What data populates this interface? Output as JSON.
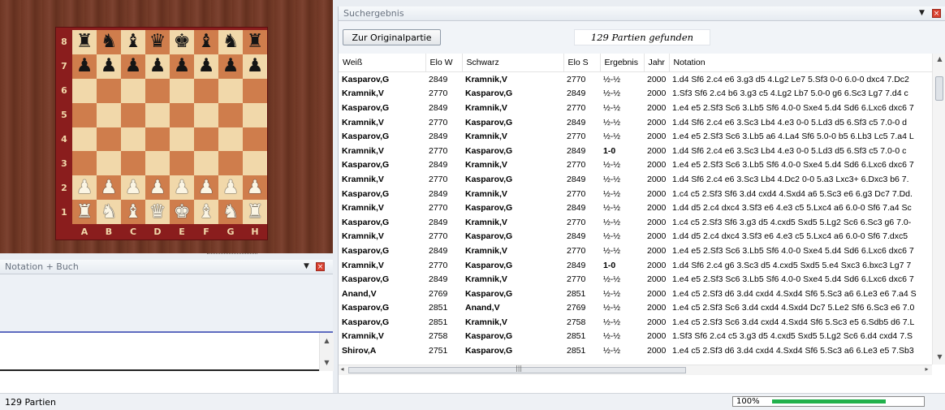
{
  "board": {
    "ranks": [
      "8",
      "7",
      "6",
      "5",
      "4",
      "3",
      "2",
      "1"
    ],
    "files": [
      "A",
      "B",
      "C",
      "D",
      "E",
      "F",
      "G",
      "H"
    ],
    "position": [
      [
        "br",
        "bn",
        "bb",
        "bq",
        "bk",
        "bb",
        "bn",
        "br"
      ],
      [
        "bp",
        "bp",
        "bp",
        "bp",
        "bp",
        "bp",
        "bp",
        "bp"
      ],
      [
        "",
        "",
        "",
        "",
        "",
        "",
        "",
        ""
      ],
      [
        "",
        "",
        "",
        "",
        "",
        "",
        "",
        ""
      ],
      [
        "",
        "",
        "",
        "",
        "",
        "",
        "",
        ""
      ],
      [
        "",
        "",
        "",
        "",
        "",
        "",
        "",
        ""
      ],
      [
        "wp",
        "wp",
        "wp",
        "wp",
        "wp",
        "wp",
        "wp",
        "wp"
      ],
      [
        "wr",
        "wn",
        "wb",
        "wq",
        "wk",
        "wb",
        "wn",
        "wr"
      ]
    ]
  },
  "notation_panel": {
    "title": "Notation + Buch"
  },
  "result_panel": {
    "title": "Suchergebnis",
    "original_button": "Zur Originalpartie",
    "found_text": "129 Partien gefunden",
    "columns": [
      "Weiß",
      "Elo W",
      "Schwarz",
      "Elo S",
      "Ergebnis",
      "Jahr",
      "Notation"
    ],
    "rows": [
      [
        "Kasparov,G",
        "2849",
        "Kramnik,V",
        "2770",
        "½-½",
        "2000",
        "1.d4 Sf6 2.c4 e6 3.g3 d5 4.Lg2 Le7 5.Sf3 0-0 6.0-0 dxc4 7.Dc2"
      ],
      [
        "Kramnik,V",
        "2770",
        "Kasparov,G",
        "2849",
        "½-½",
        "2000",
        "1.Sf3 Sf6 2.c4 b6 3.g3 c5 4.Lg2 Lb7 5.0-0 g6 6.Sc3 Lg7 7.d4 c"
      ],
      [
        "Kasparov,G",
        "2849",
        "Kramnik,V",
        "2770",
        "½-½",
        "2000",
        "1.e4 e5 2.Sf3 Sc6 3.Lb5 Sf6 4.0-0 Sxe4 5.d4 Sd6 6.Lxc6 dxc6 7"
      ],
      [
        "Kramnik,V",
        "2770",
        "Kasparov,G",
        "2849",
        "½-½",
        "2000",
        "1.d4 Sf6 2.c4 e6 3.Sc3 Lb4 4.e3 0-0 5.Ld3 d5 6.Sf3 c5 7.0-0 d"
      ],
      [
        "Kasparov,G",
        "2849",
        "Kramnik,V",
        "2770",
        "½-½",
        "2000",
        "1.e4 e5 2.Sf3 Sc6 3.Lb5 a6 4.La4 Sf6 5.0-0 b5 6.Lb3 Lc5 7.a4 L"
      ],
      [
        "Kramnik,V",
        "2770",
        "Kasparov,G",
        "2849",
        "1-0",
        "2000",
        "1.d4 Sf6 2.c4 e6 3.Sc3 Lb4 4.e3 0-0 5.Ld3 d5 6.Sf3 c5 7.0-0 c"
      ],
      [
        "Kasparov,G",
        "2849",
        "Kramnik,V",
        "2770",
        "½-½",
        "2000",
        "1.e4 e5 2.Sf3 Sc6 3.Lb5 Sf6 4.0-0 Sxe4 5.d4 Sd6 6.Lxc6 dxc6 7"
      ],
      [
        "Kramnik,V",
        "2770",
        "Kasparov,G",
        "2849",
        "½-½",
        "2000",
        "1.d4 Sf6 2.c4 e6 3.Sc3 Lb4 4.Dc2 0-0 5.a3 Lxc3+ 6.Dxc3 b6 7."
      ],
      [
        "Kasparov,G",
        "2849",
        "Kramnik,V",
        "2770",
        "½-½",
        "2000",
        "1.c4 c5 2.Sf3 Sf6 3.d4 cxd4 4.Sxd4 a6 5.Sc3 e6 6.g3 Dc7 7.Dd."
      ],
      [
        "Kramnik,V",
        "2770",
        "Kasparov,G",
        "2849",
        "½-½",
        "2000",
        "1.d4 d5 2.c4 dxc4 3.Sf3 e6 4.e3 c5 5.Lxc4 a6 6.0-0 Sf6 7.a4 Sc"
      ],
      [
        "Kasparov,G",
        "2849",
        "Kramnik,V",
        "2770",
        "½-½",
        "2000",
        "1.c4 c5 2.Sf3 Sf6 3.g3 d5 4.cxd5 Sxd5 5.Lg2 Sc6 6.Sc3 g6 7.0-"
      ],
      [
        "Kramnik,V",
        "2770",
        "Kasparov,G",
        "2849",
        "½-½",
        "2000",
        "1.d4 d5 2.c4 dxc4 3.Sf3 e6 4.e3 c5 5.Lxc4 a6 6.0-0 Sf6 7.dxc5"
      ],
      [
        "Kasparov,G",
        "2849",
        "Kramnik,V",
        "2770",
        "½-½",
        "2000",
        "1.e4 e5 2.Sf3 Sc6 3.Lb5 Sf6 4.0-0 Sxe4 5.d4 Sd6 6.Lxc6 dxc6 7"
      ],
      [
        "Kramnik,V",
        "2770",
        "Kasparov,G",
        "2849",
        "1-0",
        "2000",
        "1.d4 Sf6 2.c4 g6 3.Sc3 d5 4.cxd5 Sxd5 5.e4 Sxc3 6.bxc3 Lg7 7"
      ],
      [
        "Kasparov,G",
        "2849",
        "Kramnik,V",
        "2770",
        "½-½",
        "2000",
        "1.e4 e5 2.Sf3 Sc6 3.Lb5 Sf6 4.0-0 Sxe4 5.d4 Sd6 6.Lxc6 dxc6 7"
      ],
      [
        "Anand,V",
        "2769",
        "Kasparov,G",
        "2851",
        "½-½",
        "2000",
        "1.e4 c5 2.Sf3 d6 3.d4 cxd4 4.Sxd4 Sf6 5.Sc3 a6 6.Le3 e6 7.a4 S"
      ],
      [
        "Kasparov,G",
        "2851",
        "Anand,V",
        "2769",
        "½-½",
        "2000",
        "1.e4 c5 2.Sf3 Sc6 3.d4 cxd4 4.Sxd4 Dc7 5.Le2 Sf6 6.Sc3 e6 7.0"
      ],
      [
        "Kasparov,G",
        "2851",
        "Kramnik,V",
        "2758",
        "½-½",
        "2000",
        "1.e4 c5 2.Sf3 Sc6 3.d4 cxd4 4.Sxd4 Sf6 5.Sc3 e5 6.Sdb5 d6 7.L"
      ],
      [
        "Kramnik,V",
        "2758",
        "Kasparov,G",
        "2851",
        "½-½",
        "2000",
        "1.Sf3 Sf6 2.c4 c5 3.g3 d5 4.cxd5 Sxd5 5.Lg2 Sc6 6.d4 cxd4 7.S"
      ],
      [
        "Shirov,A",
        "2751",
        "Kasparov,G",
        "2851",
        "½-½",
        "2000",
        "1.e4 c5 2.Sf3 d6 3.d4 cxd4 4.Sxd4 Sf6 5.Sc3 a6 6.Le3 e5 7.Sb3"
      ]
    ]
  },
  "status": {
    "count_text": "129 Partien",
    "progress_label": "100%",
    "progress_value": 1.0
  },
  "colors": {
    "board_light": "#f1d8aa",
    "board_dark": "#cf7d4c",
    "board_frame": "#8a1d1d",
    "progress_green": "#22b14c"
  },
  "icons": [
    "dropdown-arrow-icon",
    "close-icon",
    "scroll-up-icon",
    "scroll-down-icon",
    "scroll-left-icon",
    "scroll-right-icon",
    "scroll-grip-icon"
  ]
}
